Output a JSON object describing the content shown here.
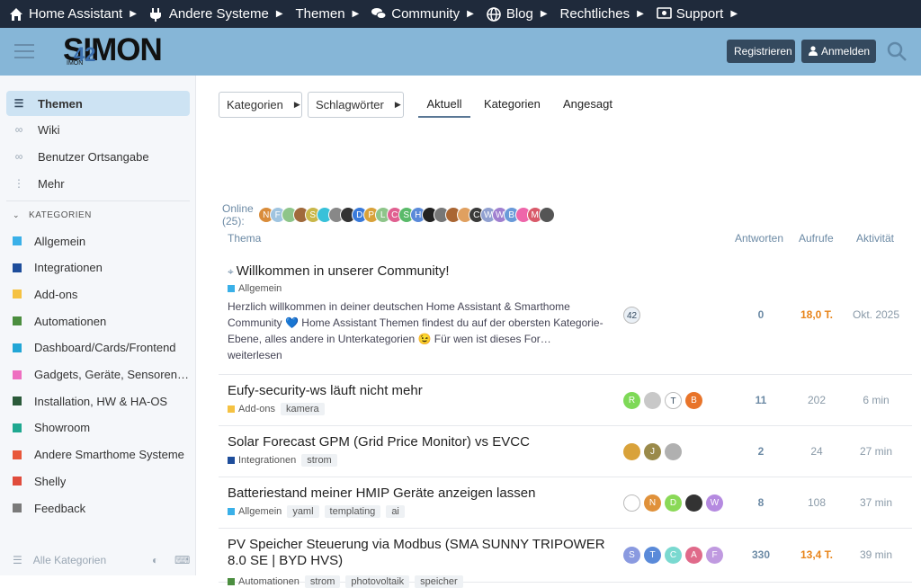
{
  "topnav": [
    {
      "label": "Home Assistant",
      "icon": "home-icon"
    },
    {
      "label": "Andere Systeme",
      "icon": "plug-icon"
    },
    {
      "label": "Themen",
      "icon": ""
    },
    {
      "label": "Community",
      "icon": "chat-icon"
    },
    {
      "label": "Blog",
      "icon": "globe-icon"
    },
    {
      "label": "Rechtliches",
      "icon": ""
    },
    {
      "label": "Support",
      "icon": "money-icon"
    }
  ],
  "header": {
    "logo_text": "SIMON",
    "logo_sub": "42",
    "logo_small": "IMON",
    "register": "Registrieren",
    "login": "Anmelden"
  },
  "sidebar": {
    "top": [
      {
        "label": "Themen",
        "icon": "layers-icon"
      },
      {
        "label": "Wiki",
        "icon": "link-icon"
      },
      {
        "label": "Benutzer Ortsangabe",
        "icon": "link-icon"
      },
      {
        "label": "Mehr",
        "icon": "dots-icon"
      }
    ],
    "section": "KATEGORIEN",
    "categories": [
      {
        "label": "Allgemein",
        "color": "#3ab0e8"
      },
      {
        "label": "Integrationen",
        "color": "#1e4d9b"
      },
      {
        "label": "Add-ons",
        "color": "#f5c242"
      },
      {
        "label": "Automationen",
        "color": "#4b8e3f"
      },
      {
        "label": "Dashboard/Cards/Frontend",
        "color": "#22a6d6"
      },
      {
        "label": "Gadgets, Geräte, Sensoren…",
        "color": "#ee6fc0"
      },
      {
        "label": "Installation, HW & HA-OS",
        "color": "#2b5a3a"
      },
      {
        "label": "Showroom",
        "color": "#1fa890"
      },
      {
        "label": "Andere Smarthome Systeme",
        "color": "#e8573a"
      },
      {
        "label": "Shelly",
        "color": "#e04c3c"
      },
      {
        "label": "Feedback",
        "color": "#7a7a7a"
      }
    ],
    "all_categories": "Alle Kategorien"
  },
  "filters": {
    "categories": "Kategorien",
    "tags": "Schlagwörter"
  },
  "tabs": [
    {
      "label": "Aktuell"
    },
    {
      "label": "Kategorien"
    },
    {
      "label": "Angesagt"
    }
  ],
  "online": {
    "label": "Online (25):",
    "avatars": [
      "N",
      "F",
      "",
      "",
      "S",
      "",
      "",
      "",
      "D",
      "P",
      "L",
      "C",
      "S",
      "H",
      "",
      "",
      "",
      "",
      "C",
      "W",
      "W",
      "B",
      "",
      "M",
      ""
    ],
    "colors": [
      "#d98c3a",
      "#9fc4e0",
      "#8ec58a",
      "#a06a3c",
      "#c9b74a",
      "#38c1d9",
      "#888",
      "#333",
      "#3a7ad9",
      "#d9a23a",
      "#8ec58a",
      "#e06090",
      "#5aba6a",
      "#5a8ad9",
      "#222",
      "#777",
      "#aa6633",
      "#e0a060",
      "#3a3a3a",
      "#90a0d0",
      "#a080d0",
      "#6a9ad9",
      "#ee66aa",
      "#d95a6a",
      "#555"
    ]
  },
  "columns": {
    "topic": "Thema",
    "replies": "Antworten",
    "views": "Aufrufe",
    "activity": "Aktivität"
  },
  "topics": [
    {
      "title": "Willkommen in unserer Community!",
      "pinned": true,
      "category": "Allgemein",
      "cat_color": "#3ab0e8",
      "tags": [],
      "excerpt": "Herzlich willkommen in deiner deutschen Home Assistant & Smarthome Community 💙 Home Assistant Themen findest du auf der obersten Kategorie-Ebene, alles andere in Unterkategorien 😉 Für wen ist dieses For… weiterlesen",
      "avatars": [
        {
          "l": "42",
          "c": "#eaf0f6"
        }
      ],
      "replies": "0",
      "views": "18,0 T.",
      "views_hot": true,
      "activity": "Okt. 2025"
    },
    {
      "title": "Eufy-security-ws läuft nicht mehr",
      "category": "Add-ons",
      "cat_color": "#f5c242",
      "tags": [
        "kamera"
      ],
      "avatars": [
        {
          "l": "R",
          "c": "#7ed957"
        },
        {
          "l": "",
          "c": "#c8c8c8"
        },
        {
          "l": "T",
          "c": "#ffffff"
        },
        {
          "l": "B",
          "c": "#e8742a"
        }
      ],
      "replies": "11",
      "views": "202",
      "activity": "6 min"
    },
    {
      "title": "Solar Forecast GPM (Grid Price Monitor) vs EVCC",
      "category": "Integrationen",
      "cat_color": "#1e4d9b",
      "tags": [
        "strom"
      ],
      "avatars": [
        {
          "l": "",
          "c": "#d9a23a"
        },
        {
          "l": "J",
          "c": "#9a8a4a"
        },
        {
          "l": "",
          "c": "#b0b0b0"
        }
      ],
      "replies": "2",
      "views": "24",
      "activity": "27 min"
    },
    {
      "title": "Batteriestand meiner HMIP Geräte anzeigen lassen",
      "category": "Allgemein",
      "cat_color": "#3ab0e8",
      "tags": [
        "yaml",
        "templating",
        "ai"
      ],
      "avatars": [
        {
          "l": "",
          "c": "#ffffff"
        },
        {
          "l": "N",
          "c": "#e0913a"
        },
        {
          "l": "D",
          "c": "#8ad957"
        },
        {
          "l": "",
          "c": "#333333"
        },
        {
          "l": "W",
          "c": "#b58ae0"
        }
      ],
      "replies": "8",
      "views": "108",
      "activity": "37 min"
    },
    {
      "title": "PV Speicher Steuerung via Modbus (SMA SUNNY TRIPOWER 8.0 SE | BYD HVS)",
      "category": "Automationen",
      "cat_color": "#4b8e3f",
      "tags": [
        "strom",
        "photovoltaik",
        "speicher"
      ],
      "avatars": [
        {
          "l": "S",
          "c": "#8a9ae0"
        },
        {
          "l": "T",
          "c": "#5a8ad9"
        },
        {
          "l": "C",
          "c": "#7ad9d0"
        },
        {
          "l": "A",
          "c": "#e06a8a"
        },
        {
          "l": "F",
          "c": "#c09ae0"
        }
      ],
      "replies": "330",
      "views": "13,4 T.",
      "views_hot": true,
      "activity": "39 min"
    }
  ]
}
